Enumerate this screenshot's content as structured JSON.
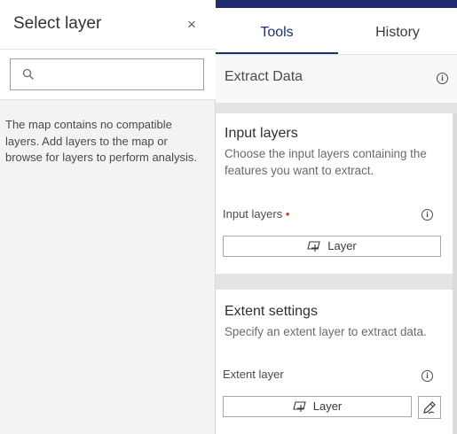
{
  "left_panel": {
    "title": "Select layer",
    "close_glyph": "×",
    "search": {
      "placeholder": "",
      "value": ""
    },
    "empty_message": "The map contains no compatible layers. Add layers to the map or browse for layers to perform analysis."
  },
  "tabs": [
    {
      "label": "Tools",
      "active": true
    },
    {
      "label": "History",
      "active": false
    }
  ],
  "tool": {
    "title": "Extract Data",
    "info_glyph": "i"
  },
  "sections": {
    "input_layers": {
      "title": "Input layers",
      "description": "Choose the input layers containing the features you want to extract.",
      "field_label": "Input layers",
      "required_marker": "•",
      "button_label": "Layer"
    },
    "extent_settings": {
      "title": "Extent settings",
      "description": "Specify an extent layer to extract data.",
      "field_label": "Extent layer",
      "button_label": "Layer"
    }
  },
  "icons": {
    "search": "search-icon",
    "close": "close-icon",
    "info": "info-icon",
    "add_layer": "add-layer-icon",
    "draw": "pencil-icon"
  },
  "colors": {
    "accent": "#1e2f73",
    "top_bar": "#1d2c6c",
    "required": "#d83020",
    "panel_bg": "#f3f3f3"
  }
}
